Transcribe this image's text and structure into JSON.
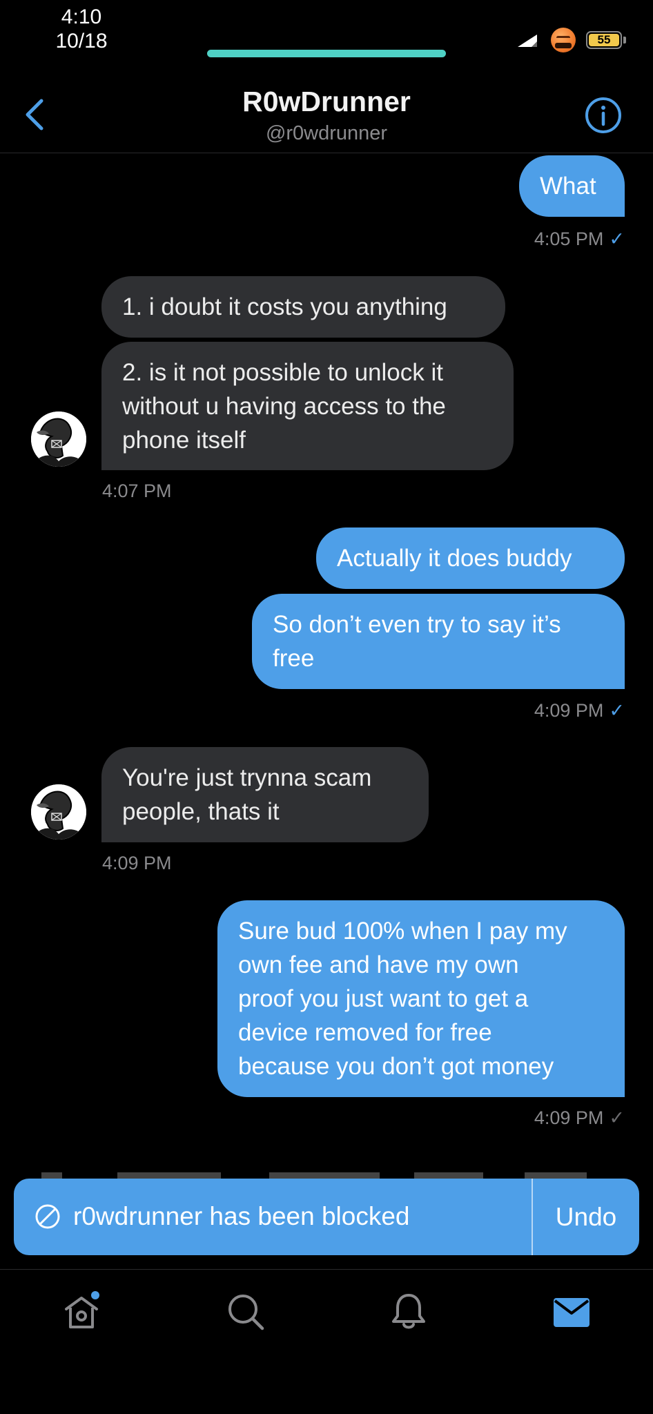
{
  "status_bar": {
    "time": "4:10",
    "date": "10/18",
    "battery_level": "55",
    "accent": "#4fd1c5"
  },
  "header": {
    "name": "R0wDrunner",
    "handle": "@r0wdrunner"
  },
  "messages": [
    {
      "direction": "out",
      "lines": [
        "What"
      ]
    },
    {
      "direction": "out-meta",
      "time": "4:05 PM",
      "status": "✓"
    },
    {
      "direction": "in",
      "lines": [
        "1. i doubt it costs you anything"
      ]
    },
    {
      "direction": "in",
      "lines": [
        "2. is it not possible to unlock it",
        "without u having access to the",
        "phone itself"
      ]
    },
    {
      "direction": "in-meta",
      "time": "4:07 PM"
    },
    {
      "direction": "out",
      "lines": [
        "Actually it does buddy"
      ]
    },
    {
      "direction": "out",
      "lines": [
        "So don’t even try to say it’s",
        "free"
      ]
    },
    {
      "direction": "out-meta",
      "time": "4:09 PM",
      "status": "✓"
    },
    {
      "direction": "in",
      "lines": [
        "You're just trynna scam",
        "people, thats it"
      ]
    },
    {
      "direction": "in-meta",
      "time": "4:09 PM"
    },
    {
      "direction": "out",
      "lines": [
        "Sure bud 100% when I pay my",
        "own fee and have my own",
        "proof you just want to get a",
        "device removed for free",
        "because you don’t got money"
      ]
    },
    {
      "direction": "out-meta",
      "time": "4:09 PM",
      "status": "✓"
    }
  ],
  "toast": {
    "message": "r0wdrunner has been blocked",
    "action": "Undo"
  },
  "tab_bar": {
    "items": [
      "home-icon",
      "search-icon",
      "notifications-icon",
      "messages-icon"
    ],
    "active": "messages-icon",
    "active_color": "#4e9fe8",
    "inactive_color": "#8a8a8d"
  },
  "colors": {
    "outgoing_bubble": "#4e9fe8",
    "incoming_bubble": "#2f3033",
    "background": "#000000"
  }
}
